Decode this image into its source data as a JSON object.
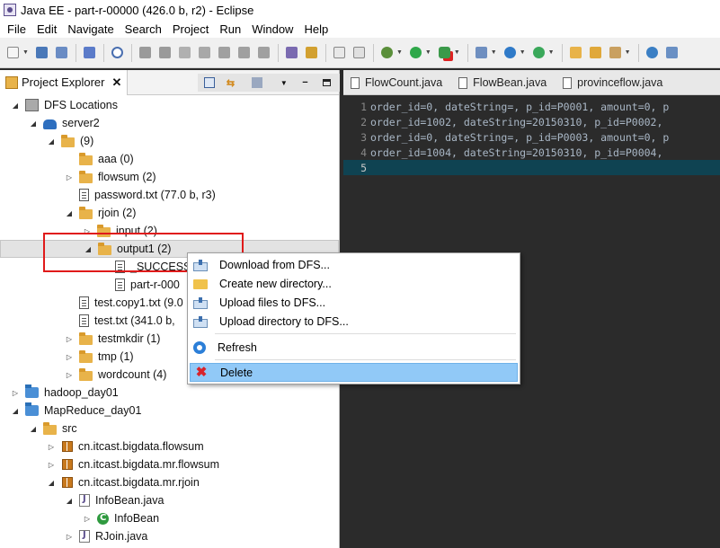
{
  "window": {
    "title": "Java EE - part-r-00000 (426.0 b, r2) - Eclipse"
  },
  "menubar": {
    "items": [
      "File",
      "Edit",
      "Navigate",
      "Search",
      "Project",
      "Run",
      "Window",
      "Help"
    ]
  },
  "project_explorer": {
    "title": "Project Explorer",
    "close_glyph": "✕",
    "tree": [
      {
        "label": "DFS Locations",
        "indent": 0,
        "twisty": "expanded",
        "icon": "dfs-root-icon"
      },
      {
        "label": "server2",
        "indent": 1,
        "twisty": "expanded",
        "icon": "hadoop-elephant-icon"
      },
      {
        "label": "(9)",
        "indent": 2,
        "twisty": "expanded",
        "icon": "folder-icon"
      },
      {
        "label": "aaa (0)",
        "indent": 3,
        "twisty": "none",
        "icon": "folder-icon"
      },
      {
        "label": "flowsum (2)",
        "indent": 3,
        "twisty": "collapsed",
        "icon": "folder-icon"
      },
      {
        "label": "password.txt (77.0 b, r3)",
        "indent": 3,
        "twisty": "none",
        "icon": "file-icon"
      },
      {
        "label": "rjoin (2)",
        "indent": 3,
        "twisty": "expanded",
        "icon": "folder-icon"
      },
      {
        "label": "input (2)",
        "indent": 4,
        "twisty": "collapsed",
        "icon": "folder-icon"
      },
      {
        "label": "output1 (2)",
        "indent": 4,
        "twisty": "expanded",
        "icon": "folder-icon",
        "selected": true
      },
      {
        "label": "_SUCCESS",
        "indent": 5,
        "twisty": "none",
        "icon": "file-icon"
      },
      {
        "label": "part-r-000",
        "indent": 5,
        "twisty": "none",
        "icon": "file-icon"
      },
      {
        "label": "test.copy1.txt (9.0",
        "indent": 3,
        "twisty": "none",
        "icon": "file-icon"
      },
      {
        "label": "test.txt (341.0 b,",
        "indent": 3,
        "twisty": "none",
        "icon": "file-icon"
      },
      {
        "label": "testmkdir (1)",
        "indent": 3,
        "twisty": "collapsed",
        "icon": "folder-icon"
      },
      {
        "label": "tmp (1)",
        "indent": 3,
        "twisty": "collapsed",
        "icon": "folder-icon"
      },
      {
        "label": "wordcount (4)",
        "indent": 3,
        "twisty": "collapsed",
        "icon": "folder-icon"
      },
      {
        "label": "hadoop_day01",
        "indent": 0,
        "twisty": "collapsed",
        "icon": "project-icon"
      },
      {
        "label": "MapReduce_day01",
        "indent": 0,
        "twisty": "expanded",
        "icon": "project-icon"
      },
      {
        "label": "src",
        "indent": 1,
        "twisty": "expanded",
        "icon": "source-folder-icon"
      },
      {
        "label": "cn.itcast.bigdata.flowsum",
        "indent": 2,
        "twisty": "collapsed",
        "icon": "package-icon"
      },
      {
        "label": "cn.itcast.bigdata.mr.flowsum",
        "indent": 2,
        "twisty": "collapsed",
        "icon": "package-icon"
      },
      {
        "label": "cn.itcast.bigdata.mr.rjoin",
        "indent": 2,
        "twisty": "expanded",
        "icon": "package-icon"
      },
      {
        "label": "InfoBean.java",
        "indent": 3,
        "twisty": "expanded",
        "icon": "java-file-icon"
      },
      {
        "label": "InfoBean",
        "indent": 4,
        "twisty": "collapsed",
        "icon": "class-icon"
      },
      {
        "label": "RJoin.java",
        "indent": 3,
        "twisty": "collapsed",
        "icon": "java-file-icon"
      }
    ]
  },
  "editor": {
    "tabs": [
      "FlowCount.java",
      "FlowBean.java",
      "provinceflow.java"
    ],
    "lines": [
      {
        "num": "1",
        "text": "order_id=0, dateString=, p_id=P0001, amount=0, p"
      },
      {
        "num": "2",
        "text": "order_id=1002, dateString=20150310, p_id=P0002, "
      },
      {
        "num": "3",
        "text": "order_id=0, dateString=, p_id=P0003, amount=0, p"
      },
      {
        "num": "4",
        "text": "order_id=1004, dateString=20150310, p_id=P0004, "
      },
      {
        "num": "5",
        "text": ""
      }
    ]
  },
  "context_menu": {
    "download": "Download from DFS...",
    "create_dir": "Create new directory...",
    "upload_files": "Upload files to DFS...",
    "upload_dir": "Upload directory to DFS...",
    "refresh": "Refresh",
    "delete": "Delete"
  },
  "colors": {
    "highlight": "#91c9f7",
    "annotation_red": "#e01a1a",
    "editor_bg": "#2b2b2b",
    "current_line": "#0f4352"
  }
}
